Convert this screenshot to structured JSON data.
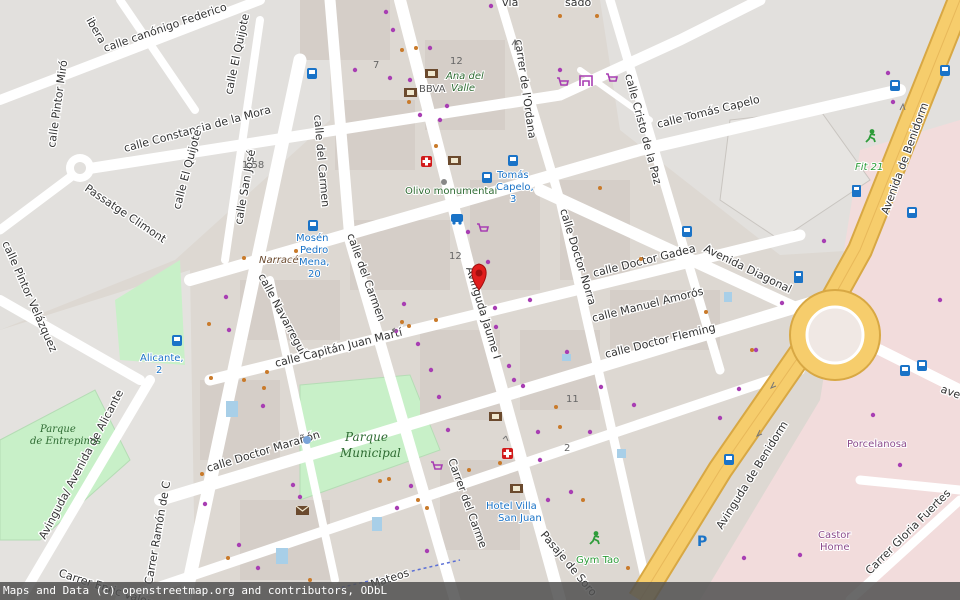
{
  "colors": {
    "background": "#ddd8d2",
    "road": "#ffffff",
    "motorway": "#f6cd6c",
    "motorway_edge": "#d8a844",
    "park": "#c8f0c8",
    "commercial": "#f2dcdc",
    "marker": "#e11d1d",
    "transit_icon": "#1a73c7",
    "shop_icon": "#a83eb3"
  },
  "streets": {
    "canonigo": "calle canónigo Federico",
    "quijote_n": "calle El Quijote",
    "pintor_miro": "calle Pintor Miró",
    "constancia": "calle Constancia de la Mora",
    "quijote_s": "calle El Quijote",
    "climont": "Passatge Climont",
    "pintor_velazquez": "calle Pintor Velázquez",
    "san_jose": "calle San José",
    "del_carmen_n": "calle del Carmen",
    "del_carmen_s": "calle del Carmen",
    "navarregui": "calle Navarregui",
    "capitan": "calle Capitán Juan Martí",
    "maranon": "calle Doctor Marañón",
    "avda_alicante": "Avinguda/ Avenida de Alicante",
    "enric_valor": "Carrer Enric Valor",
    "ramon": "Carrer Ramón de C",
    "mateos": "Mateos",
    "carrer_carme": "Carrer del Carme",
    "jaume": "Avinguda Jaume I",
    "sorolla": "Pasaje de Soro",
    "ordana": "carrer de l'Ordana",
    "doctor_norra": "calle Doctor Norra",
    "cristo_paz": "calle Cristo de la Paz",
    "tomas_capelo": "calle Tomás Capelo",
    "doctor_gadea": "calle Doctor Gadea",
    "avda_diagonal": "Avenida Diagonal",
    "manuel_amoros": "calle Manuel Amorós",
    "doctor_fleming": "calle Doctor Fleming",
    "avda_benidorm_n": "Avenida de Benidorm",
    "avda_benidorm_s": "Avinguda de Benidorm",
    "gloria_fuertes": "Carrer Gloria Fuertes",
    "ave": "ave",
    "ibera": "ibera",
    "sado": "sado",
    "via": "via"
  },
  "pois": {
    "bbva": "BBVA",
    "ana_valle_1": "Ana del",
    "ana_valle_2": "Valle",
    "olivo": "Olivo monumental",
    "tomas_stop_1": "Tomás",
    "tomas_stop_2": "Capelo,",
    "tomas_stop_3": "3",
    "mosen_1": "Mosén",
    "mosen_2": "Pedro",
    "mosen_3": "Mena,",
    "mosen_4": "20",
    "narrace": "Narracé",
    "alicante_1": "Alicante,",
    "alicante_2": "2",
    "fit21": "Fit 21",
    "porcelanosa": "Porcelanosa",
    "castor_1": "Castor",
    "castor_2": "Home",
    "hotel_1": "Hotel Villa",
    "hotel_2": "San Juan",
    "gym_tao": "Gym Tao"
  },
  "parks": {
    "municipal_1": "Parque",
    "municipal_2": "Municipal",
    "entrepinos_1": "Parque",
    "entrepinos_2": "de Entrepinos"
  },
  "numbers": {
    "n7": "7",
    "n12a": "12",
    "n12b": "12",
    "n158": "1,58",
    "n11": "11",
    "n2": "2"
  },
  "icons": {
    "bus": "bus-stop-icon",
    "shop": "shopping-cart-icon",
    "bank": "bank-icon",
    "pharmacy": "pharmacy-icon",
    "fuel": "fuel-station-icon",
    "taxi": "taxi-icon",
    "fitness": "fitness-icon",
    "post": "post-office-icon",
    "parking": "parking-icon",
    "marker": "location-marker-icon"
  },
  "attribution": "Maps and Data (c) openstreetmap.org and contributors, ODbL"
}
